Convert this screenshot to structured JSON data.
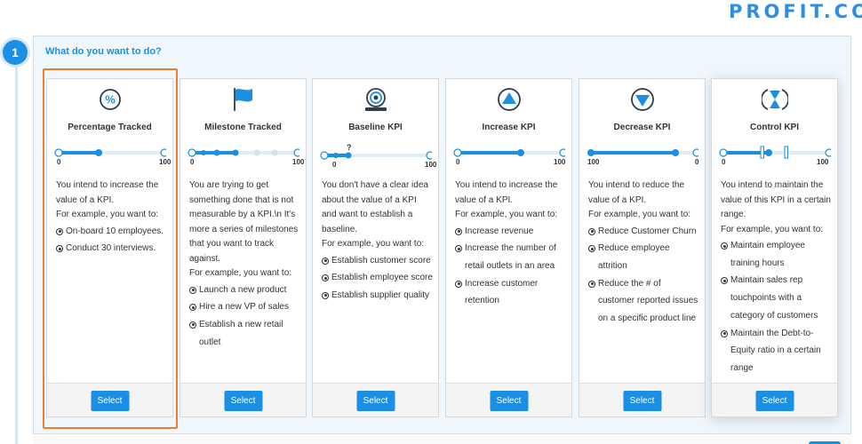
{
  "brand": {
    "logo_text": "PROFIT.CO"
  },
  "step": {
    "number": "1",
    "question": "What do you want to do?"
  },
  "colors": {
    "accent": "#1a8fe3",
    "highlight": "#ef7d2d"
  },
  "cards": [
    {
      "icon": "percentage-icon",
      "title": "Percentage Tracked",
      "slider": {
        "min_label": "0",
        "max_label": "100"
      },
      "description": "You intend to increase the value of a KPI.",
      "example_intro": "For example, you want to:",
      "examples": [
        "On-board 10 employees.",
        "Conduct 30 interviews."
      ],
      "select_label": "Select"
    },
    {
      "icon": "flag-icon",
      "title": "Milestone Tracked",
      "slider": {
        "min_label": "0",
        "max_label": "100"
      },
      "description": "You are trying to get something done that is not measurable by a KPI.\\n It's more a series of milestones that you want to track against.",
      "example_intro": "For example, you want to:",
      "examples": [
        "Launch a new product",
        "Hire a new VP of sales",
        "Establish a new retail outlet"
      ],
      "select_label": "Select"
    },
    {
      "icon": "target-icon",
      "title": "Baseline KPI",
      "slider": {
        "min_label": "0",
        "max_label": "100",
        "marker_label": "?"
      },
      "description": "You don't have a clear idea about the value of a KPI and want to establish a baseline.",
      "example_intro": "For example, you want to:",
      "examples": [
        "Establish customer score",
        "Establish employee score",
        "Establish supplier quality"
      ],
      "select_label": "Select"
    },
    {
      "icon": "arrow-up-icon",
      "title": "Increase KPI",
      "slider": {
        "min_label": "0",
        "max_label": "100"
      },
      "description": "You intend to increase the value of a KPI.",
      "example_intro": "For example, you want to:",
      "examples": [
        "Increase revenue",
        "Increase the number of retail outlets in an area",
        "Increase customer retention"
      ],
      "select_label": "Select"
    },
    {
      "icon": "arrow-down-icon",
      "title": "Decrease KPI",
      "slider": {
        "min_label": "100",
        "max_label": "0"
      },
      "description": "You intend to reduce the value of a KPI.",
      "example_intro": "For example, you want to:",
      "examples": [
        "Reduce Customer Churn",
        "Reduce employee attrition",
        "Reduce the # of customer reported issues on a specific product line"
      ],
      "select_label": "Select"
    },
    {
      "icon": "hourglass-icon",
      "title": "Control KPI",
      "slider": {
        "min_label": "0",
        "max_label": "100"
      },
      "description": "You intend to maintain the value of this KPI in a certain range.",
      "example_intro": "For example, you want to:",
      "examples": [
        "Maintain employee training hours",
        "Maintain sales rep touchpoints with a category of customers",
        "Maintain the Debt-to-Equity ratio in a certain range"
      ],
      "select_label": "Select"
    }
  ]
}
